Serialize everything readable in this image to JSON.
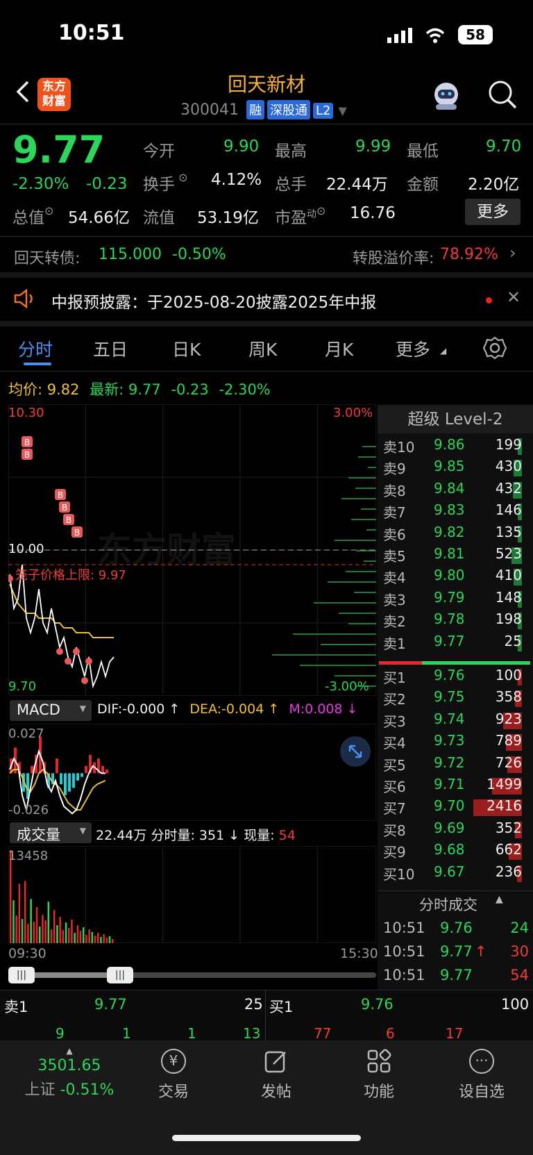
{
  "status_bar": {
    "time": "10:51",
    "battery": "58"
  },
  "header": {
    "brand_logo_line1": "东方",
    "brand_logo_line2": "财富",
    "stock_name": "回天新材",
    "stock_code": "300041",
    "tags": [
      "融",
      "深股通",
      "L2"
    ]
  },
  "quote": {
    "price": "9.77",
    "change_pct": "-2.30%",
    "change": "-0.23",
    "open_label": "今开",
    "open": "9.90",
    "high_label": "最高",
    "high": "9.99",
    "low_label": "最低",
    "low": "9.70",
    "turnover_label": "换手",
    "turnover": "4.12%",
    "volume_label": "总手",
    "volume": "22.44万",
    "amount_label": "金额",
    "amount": "2.20亿",
    "mktcap_label": "总值",
    "mktcap": "54.66亿",
    "float_label": "流值",
    "float": "53.19亿",
    "pe_label": "市盈",
    "pe_sup": "动",
    "pe": "16.76",
    "more_button": "更多"
  },
  "bond": {
    "label": "回天转债:",
    "price": "115.000",
    "change": "-0.50%",
    "premium_label": "转股溢价率:",
    "premium": "78.92%"
  },
  "notice": {
    "text": "中报预披露：于2025-08-20披露2025年中报"
  },
  "tabs": [
    "分时",
    "五日",
    "日K",
    "周K",
    "月K",
    "更多"
  ],
  "chart_info": {
    "avg_label": "均价:",
    "avg": "9.82",
    "last_label": "最新:",
    "last": "9.77",
    "change": "-0.23",
    "change_pct": "-2.30%"
  },
  "chart_data": {
    "type": "line",
    "ylim": [
      9.7,
      10.3
    ],
    "y_top_label": "10.30",
    "y_bottom_label": "9.70",
    "y_mid_label": "10.00",
    "pct_top_label": "3.00%",
    "pct_bottom_label": "-3.00%",
    "limit_label": "笼子价格上限: 9.97",
    "watermark": "东方财富",
    "price_series": [
      9.95,
      9.88,
      9.9,
      9.97,
      9.86,
      9.83,
      9.86,
      9.92,
      9.85,
      9.83,
      9.88,
      9.84,
      9.8,
      9.82,
      9.78,
      9.76,
      9.8,
      9.77,
      9.74,
      9.78,
      9.72,
      9.74,
      9.77,
      9.74,
      9.77,
      9.78
    ],
    "avg_series": [
      9.93,
      9.91,
      9.89,
      9.88,
      9.87,
      9.87,
      9.87,
      9.86,
      9.86,
      9.86,
      9.86,
      9.85,
      9.85,
      9.84,
      9.84,
      9.84,
      9.83,
      9.83,
      9.83,
      9.83,
      9.82,
      9.82,
      9.82,
      9.82,
      9.82,
      9.82
    ],
    "macd": {
      "label": "MACD",
      "dif_label": "DIF:-0.000 ↑",
      "dea_label": "DEA:-0.004 ↑",
      "m_label": "M:0.008 ↓",
      "ylim": [
        -0.026,
        0.027
      ],
      "y_top_label": "0.027",
      "y_bottom_label": "-0.026",
      "hist": [
        0.008,
        0.014,
        0.006,
        -0.01,
        -0.014,
        0.004,
        0.01,
        0.02,
        0.006,
        -0.008,
        -0.006,
        0.008,
        -0.006,
        -0.012,
        -0.01,
        -0.008,
        -0.004,
        -0.002,
        0.004,
        0.01,
        0.006,
        0.008,
        0.004,
        0.002
      ],
      "dif": [
        0.002,
        0.008,
        0.004,
        -0.012,
        -0.02,
        -0.008,
        0.004,
        0.012,
        0.006,
        -0.006,
        -0.01,
        -0.004,
        -0.012,
        -0.018,
        -0.02,
        -0.022,
        -0.02,
        -0.014,
        -0.006,
        0.0,
        0.004,
        0.002,
        0.0,
        -0.0
      ],
      "dea": [
        0.0,
        0.002,
        0.002,
        -0.002,
        -0.008,
        -0.01,
        -0.006,
        0.0,
        0.002,
        0.0,
        -0.004,
        -0.006,
        -0.008,
        -0.012,
        -0.016,
        -0.018,
        -0.02,
        -0.02,
        -0.016,
        -0.012,
        -0.008,
        -0.006,
        -0.005,
        -0.004
      ]
    },
    "volume": {
      "label": "成交量",
      "total": "22.44万",
      "minute_label": "分时量:",
      "minute": "351 ↓",
      "now_label": "现量:",
      "now": "54",
      "y_top_label": "13458",
      "bars": [
        13458,
        6200,
        4000,
        8600,
        3500,
        9000,
        2800,
        6400,
        3100,
        5200,
        2400,
        4100,
        3300,
        6000,
        2000,
        4800,
        2600,
        3800,
        1900,
        3000,
        2200,
        3400,
        1500,
        2600,
        1800,
        2300,
        1200,
        2000,
        1600,
        1100,
        1500,
        900,
        1300,
        800,
        1000,
        600
      ]
    },
    "x_start_label": "09:30",
    "x_end_label": "15:30"
  },
  "orderbook": {
    "title": "超级 Level-2",
    "asks": [
      {
        "label": "卖10",
        "price": "9.86",
        "vol": "199",
        "v": 199
      },
      {
        "label": "卖9",
        "price": "9.85",
        "vol": "430",
        "v": 430
      },
      {
        "label": "卖8",
        "price": "9.84",
        "vol": "432",
        "v": 432
      },
      {
        "label": "卖7",
        "price": "9.83",
        "vol": "146",
        "v": 146
      },
      {
        "label": "卖6",
        "price": "9.82",
        "vol": "135",
        "v": 135
      },
      {
        "label": "卖5",
        "price": "9.81",
        "vol": "523",
        "v": 523
      },
      {
        "label": "卖4",
        "price": "9.80",
        "vol": "410",
        "v": 410
      },
      {
        "label": "卖3",
        "price": "9.79",
        "vol": "148",
        "v": 148
      },
      {
        "label": "卖2",
        "price": "9.78",
        "vol": "198",
        "v": 198
      },
      {
        "label": "卖1",
        "price": "9.77",
        "vol": "25",
        "v": 25
      }
    ],
    "bids": [
      {
        "label": "买1",
        "price": "9.76",
        "vol": "100",
        "v": 100
      },
      {
        "label": "买2",
        "price": "9.75",
        "vol": "358",
        "v": 358
      },
      {
        "label": "买3",
        "price": "9.74",
        "vol": "923",
        "v": 923
      },
      {
        "label": "买4",
        "price": "9.73",
        "vol": "789",
        "v": 789
      },
      {
        "label": "买5",
        "price": "9.72",
        "vol": "726",
        "v": 726
      },
      {
        "label": "买6",
        "price": "9.71",
        "vol": "1499",
        "v": 1499
      },
      {
        "label": "买7",
        "price": "9.70",
        "vol": "2416",
        "v": 2416
      },
      {
        "label": "买8",
        "price": "9.69",
        "vol": "352",
        "v": 352
      },
      {
        "label": "买9",
        "price": "9.68",
        "vol": "662",
        "v": 662
      },
      {
        "label": "买10",
        "price": "9.67",
        "vol": "236",
        "v": 236
      }
    ],
    "ticks_title": "分时成交",
    "ticks": [
      {
        "time": "10:51",
        "price": "9.76",
        "vol": "24",
        "dir": ""
      },
      {
        "time": "10:51",
        "price": "9.77",
        "vol": "30",
        "dir": "↑"
      },
      {
        "time": "10:51",
        "price": "9.77",
        "vol": "54",
        "dir": ""
      }
    ]
  },
  "bottom_quote": {
    "ask_label": "卖1",
    "ask_price": "9.77",
    "ask_vol": "25",
    "bid_label": "买1",
    "bid_price": "9.76",
    "bid_vol": "100",
    "ask_queue": [
      "9",
      "1",
      "1",
      "13"
    ],
    "bid_queue": [
      "77",
      "6",
      "17"
    ]
  },
  "bottom_nav": {
    "index_value": "3501.65",
    "index_name": "上证",
    "index_change": "-0.51%",
    "items": [
      "交易",
      "发帖",
      "功能",
      "设自选"
    ]
  }
}
